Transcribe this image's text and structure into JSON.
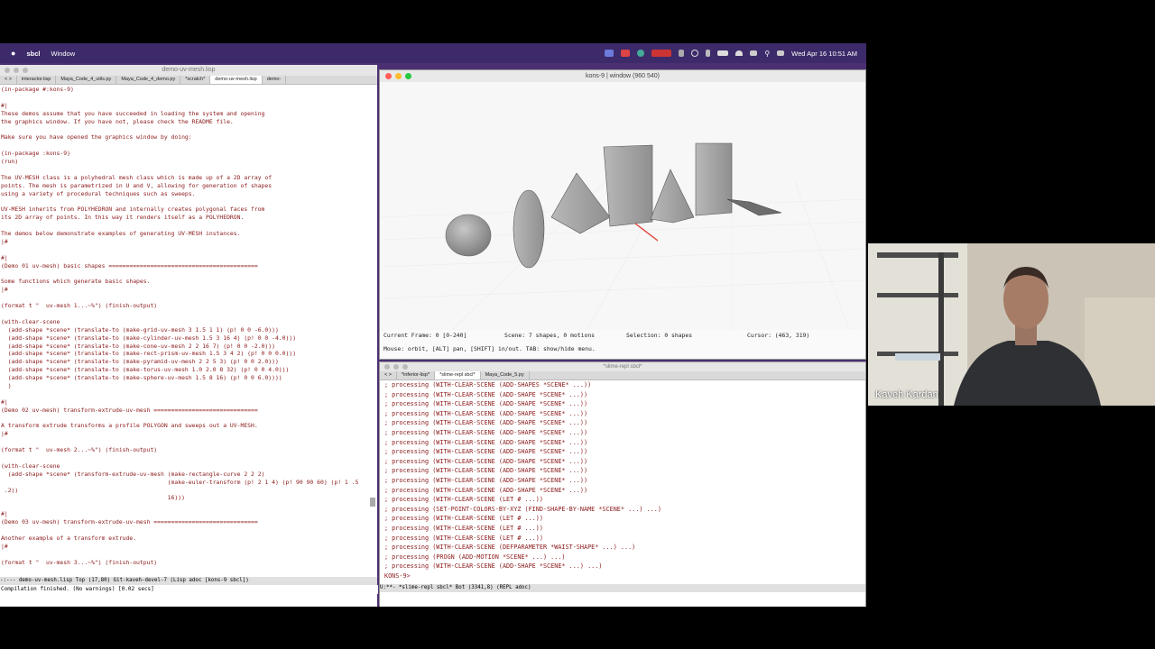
{
  "menubar": {
    "app_name": "sbcl",
    "menu_window": "Window",
    "datetime": "Wed Apr 16  10:51 AM"
  },
  "emacs": {
    "title": "demo-uv-mesh.lisp",
    "tabs": [
      {
        "label": "interactor.lisp",
        "active": false
      },
      {
        "label": "Maya_Code_4_utils.py",
        "active": false
      },
      {
        "label": "Maya_Code_4_demo.py",
        "active": false
      },
      {
        "label": "*scratch*",
        "active": false
      },
      {
        "label": "demo-uv-mesh.lisp",
        "active": true
      },
      {
        "label": "demo-",
        "active": false
      }
    ],
    "code_lines": [
      "(in-package #:kons-9)",
      "",
      "#|",
      "These demos assume that you have succeeded in loading the system and opening",
      "the graphics window. If you have not, please check the README file.",
      "",
      "Make sure you have opened the graphics window by doing:",
      "",
      "(in-package :kons-9)",
      "(run)",
      "",
      "The UV-MESH class is a polyhedral mesh class which is made up of a 2D array of",
      "points. The mesh is parametrized in U and V, allowing for generation of shapes",
      "using a variety of procedural techniques such as sweeps.",
      "",
      "UV-MESH inherits from POLYHEDRON and internally creates polygonal faces from",
      "its 2D array of points. In this way it renders itself as a POLYHEDRON.",
      "",
      "The demos below demonstrate examples of generating UV-MESH instances.",
      "|#",
      "",
      "#|",
      "(Demo 01 uv-mesh) basic shapes ===========================================",
      "",
      "Some functions which generate basic shapes.",
      "|#",
      "",
      "(format t \"  uv-mesh 1...~%\") (finish-output)",
      "",
      "(with-clear-scene",
      "  (add-shape *scene* (translate-to (make-grid-uv-mesh 3 1.5 1 1) (p! 0 0 -6.0)))",
      "  (add-shape *scene* (translate-to (make-cylinder-uv-mesh 1.5 3 16 4) (p! 0 0 -4.0)))",
      "  (add-shape *scene* (translate-to (make-cone-uv-mesh 2 2 16 7) (p! 0 0 -2.0)))",
      "  (add-shape *scene* (translate-to (make-rect-prism-uv-mesh 1.5 3 4 2) (p! 0 0 0.0)))",
      "  (add-shape *scene* (translate-to (make-pyramid-uv-mesh 2 2 5 3) (p! 0 0 2.0)))",
      "  (add-shape *scene* (translate-to (make-torus-uv-mesh 1.0 2.0 8 32) (p! 0 0 4.0)))",
      "  (add-shape *scene* (translate-to (make-sphere-uv-mesh 1.5 8 16) (p! 0 0 6.0))))",
      "  )",
      "",
      "#|",
      "(Demo 02 uv-mesh) transform-extrude-uv-mesh ==============================",
      "",
      "A transform extrude transforms a profile POLYGON and sweeps out a UV-MESH.",
      "|#",
      "",
      "(format t \"  uv-mesh 2...~%\") (finish-output)",
      "",
      "(with-clear-scene",
      "  (add-shape *scene* (transform-extrude-uv-mesh (make-rectangle-curve 2 2 2)",
      "                                                (make-euler-transform (p! 2 1 4) (p! 90 90 60) (p! 1 .5",
      " .2))",
      "                                                16)))",
      "",
      "#|",
      "(Demo 03 uv-mesh) transform-extrude-uv-mesh ==============================",
      "",
      "Another example of a transform extrude.",
      "|#",
      "",
      "(format t \"  uv-mesh 3...~%\") (finish-output)"
    ],
    "modeline": "-:---  demo-uv-mesh.lisp    Top (17,80)   Git-kaveh-devel-7  (Lisp adoc [kons-9 sbcl])",
    "echo": "Compilation finished. (No warnings) [0.02 secs]"
  },
  "kons": {
    "title": "kons-9 | window (960 540)",
    "current_frame": "Current Frame: 0 [0-240]",
    "scene_info": "Scene: 7 shapes, 0 motions",
    "selection": "Selection: 0 shapes",
    "cursor": "Cursor: (463, 319)",
    "help": "Mouse: orbit, [ALT] pan, [SHIFT] in/out. TAB: show/hide menu."
  },
  "repl": {
    "title": "*slime-repl sbcl*",
    "tabs": [
      {
        "label": "*inferior-lisp*",
        "active": false
      },
      {
        "label": "*slime-repl sbcl*",
        "active": true
      },
      {
        "label": "Maya_Code_5.py",
        "active": false
      }
    ],
    "lines": [
      "; processing (WITH-CLEAR-SCENE (ADD-SHAPES *SCENE* ...))",
      "; processing (WITH-CLEAR-SCENE (ADD-SHAPE *SCENE* ...))",
      "; processing (WITH-CLEAR-SCENE (ADD-SHAPE *SCENE* ...))",
      "; processing (WITH-CLEAR-SCENE (ADD-SHAPE *SCENE* ...))",
      "; processing (WITH-CLEAR-SCENE (ADD-SHAPE *SCENE* ...))",
      "; processing (WITH-CLEAR-SCENE (ADD-SHAPE *SCENE* ...))",
      "; processing (WITH-CLEAR-SCENE (ADD-SHAPE *SCENE* ...))",
      "; processing (WITH-CLEAR-SCENE (ADD-SHAPE *SCENE* ...))",
      "; processing (WITH-CLEAR-SCENE (ADD-SHAPE *SCENE* ...))",
      "; processing (WITH-CLEAR-SCENE (ADD-SHAPE *SCENE* ...))",
      "; processing (WITH-CLEAR-SCENE (ADD-SHAPE *SCENE* ...))",
      "; processing (WITH-CLEAR-SCENE (ADD-SHAPE *SCENE* ...))",
      "; processing (WITH-CLEAR-SCENE (LET # ...))",
      "; processing (SET-POINT-COLORS-BY-XYZ (FIND-SHAPE-BY-NAME *SCENE* ...) ...)",
      "; processing (WITH-CLEAR-SCENE (LET # ...))",
      "; processing (WITH-CLEAR-SCENE (LET # ...))",
      "; processing (WITH-CLEAR-SCENE (LET # ...))",
      "; processing (WITH-CLEAR-SCENE (DEFPARAMETER *WAIST-SHAPE* ...) ...)",
      "; processing (PROGN (ADD-MOTION *SCENE* ...) ...)",
      "; processing (WITH-CLEAR-SCENE (ADD-SHAPE *SCENE* ...) ...)"
    ],
    "prompt": "KONS-9> ",
    "modeline": "U:**-  *slime-repl sbcl*   Bot (3341,8)   (REPL adoc)"
  },
  "webcam": {
    "name": "Kaveh Kardan"
  },
  "colors": {
    "desktop": "#4b2f73",
    "code_text": "#8b1a1a",
    "accent_red": "#e0443a"
  }
}
